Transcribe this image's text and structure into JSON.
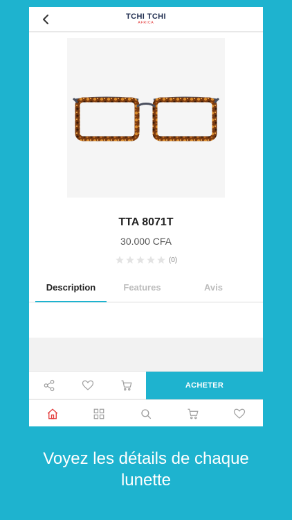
{
  "header": {
    "back_icon": "chevron-left-icon",
    "logo_main": "TCHI TCHI",
    "logo_sub": "AFRICA"
  },
  "product": {
    "image": "tortoiseshell-glasses",
    "name": "TTA 8071T",
    "price": "30.000 CFA",
    "rating": 0,
    "rating_max": 5,
    "rating_count": "(0)"
  },
  "tabs": [
    {
      "label": "Description",
      "active": true
    },
    {
      "label": "Features",
      "active": false
    },
    {
      "label": "Avis",
      "active": false
    }
  ],
  "actions": {
    "share_icon": "share-icon",
    "favorite_icon": "heart-icon",
    "cart_icon": "cart-icon",
    "buy_label": "ACHETER"
  },
  "bottom_nav": [
    {
      "icon": "home-icon",
      "active": true
    },
    {
      "icon": "grid-icon",
      "active": false
    },
    {
      "icon": "search-icon",
      "active": false
    },
    {
      "icon": "cart-icon",
      "active": false
    },
    {
      "icon": "heart-icon",
      "active": false
    }
  ],
  "caption": {
    "line1": "Voyez les détails de chaque",
    "line2": "lunette"
  },
  "colors": {
    "accent": "#1eb3cf",
    "active_nav": "#e33a3a",
    "logo_dark": "#1f2d4f"
  }
}
